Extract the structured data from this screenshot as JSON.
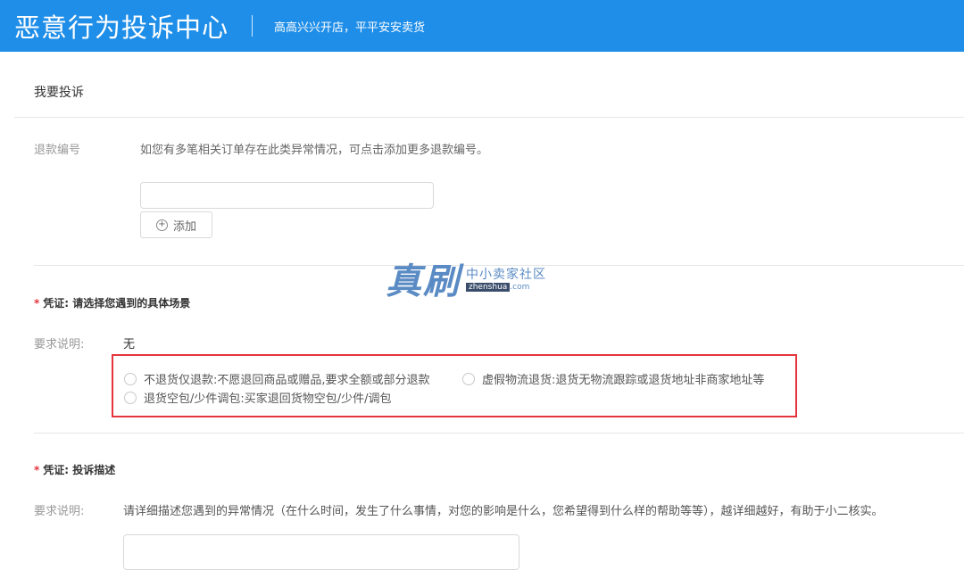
{
  "header": {
    "title": "恶意行为投诉中心",
    "slogan": "高高兴兴开店，平平安安卖货"
  },
  "section": {
    "title": "我要投诉"
  },
  "refund": {
    "label": "退款编号",
    "hint": "如您有多笔相关订单存在此类异常情况，可点击添加更多退款编号。",
    "input_value": "",
    "add_label": "添加"
  },
  "scenario": {
    "required_mark": "*",
    "title": "凭证: 请选择您遇到的具体场景",
    "req_label": "要求说明:",
    "req_value": "无",
    "options": [
      "不退货仅退款:不愿退回商品或赠品,要求全额或部分退款",
      "虚假物流退货:退货无物流跟踪或退货地址非商家地址等",
      "退货空包/少件调包:买家退回货物空包/少件/调包"
    ]
  },
  "description": {
    "required_mark": "*",
    "title": "凭证: 投诉描述",
    "req_label": "要求说明:",
    "req_value": "请详细描述您遇到的异常情况（在什么时间，发生了什么事情，对您的影响是什么，您希望得到什么样的帮助等等），越详细越好，有助于小二核实。"
  },
  "watermark": {
    "big": "真刷",
    "cn": "中小卖家社区",
    "site": "zhenshua",
    "tld": ".com"
  },
  "colors": {
    "header_bg": "#1f8ee8",
    "required": "#e5343c",
    "highlight_box": "#e5343c"
  }
}
